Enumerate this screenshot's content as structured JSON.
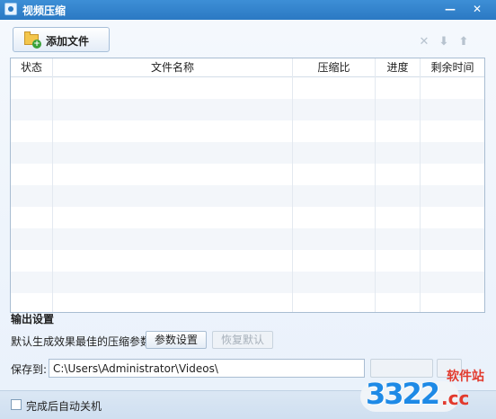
{
  "window": {
    "title": "视频压缩",
    "minimize_glyph": "—",
    "close_glyph": "✕"
  },
  "toolbar": {
    "add_file_label": "添加文件",
    "add_file_icon": "folder-add-icon",
    "remove_icon": "close-icon",
    "move_down_icon": "arrow-down-icon",
    "move_up_icon": "arrow-up-icon"
  },
  "table": {
    "columns": [
      "状态",
      "文件名称",
      "压缩比",
      "进度",
      "剩余时间"
    ],
    "rows": []
  },
  "output": {
    "section_title": "输出设置",
    "description": "默认生成效果最佳的压缩参数",
    "params_button": "参数设置",
    "restore_button": "恢复默认",
    "save_label": "保存到:",
    "save_path": "C:\\Users\\Administrator\\Videos\\"
  },
  "footer": {
    "auto_shutdown_label": "完成后自动关机",
    "auto_shutdown_checked": false
  },
  "watermark": {
    "digits": "3322",
    "domain": ".cc",
    "site": "软件站"
  },
  "colors": {
    "titlebar": "#2b79c3",
    "accent": "#1e8ae6",
    "watermark_red": "#e23a2d"
  }
}
